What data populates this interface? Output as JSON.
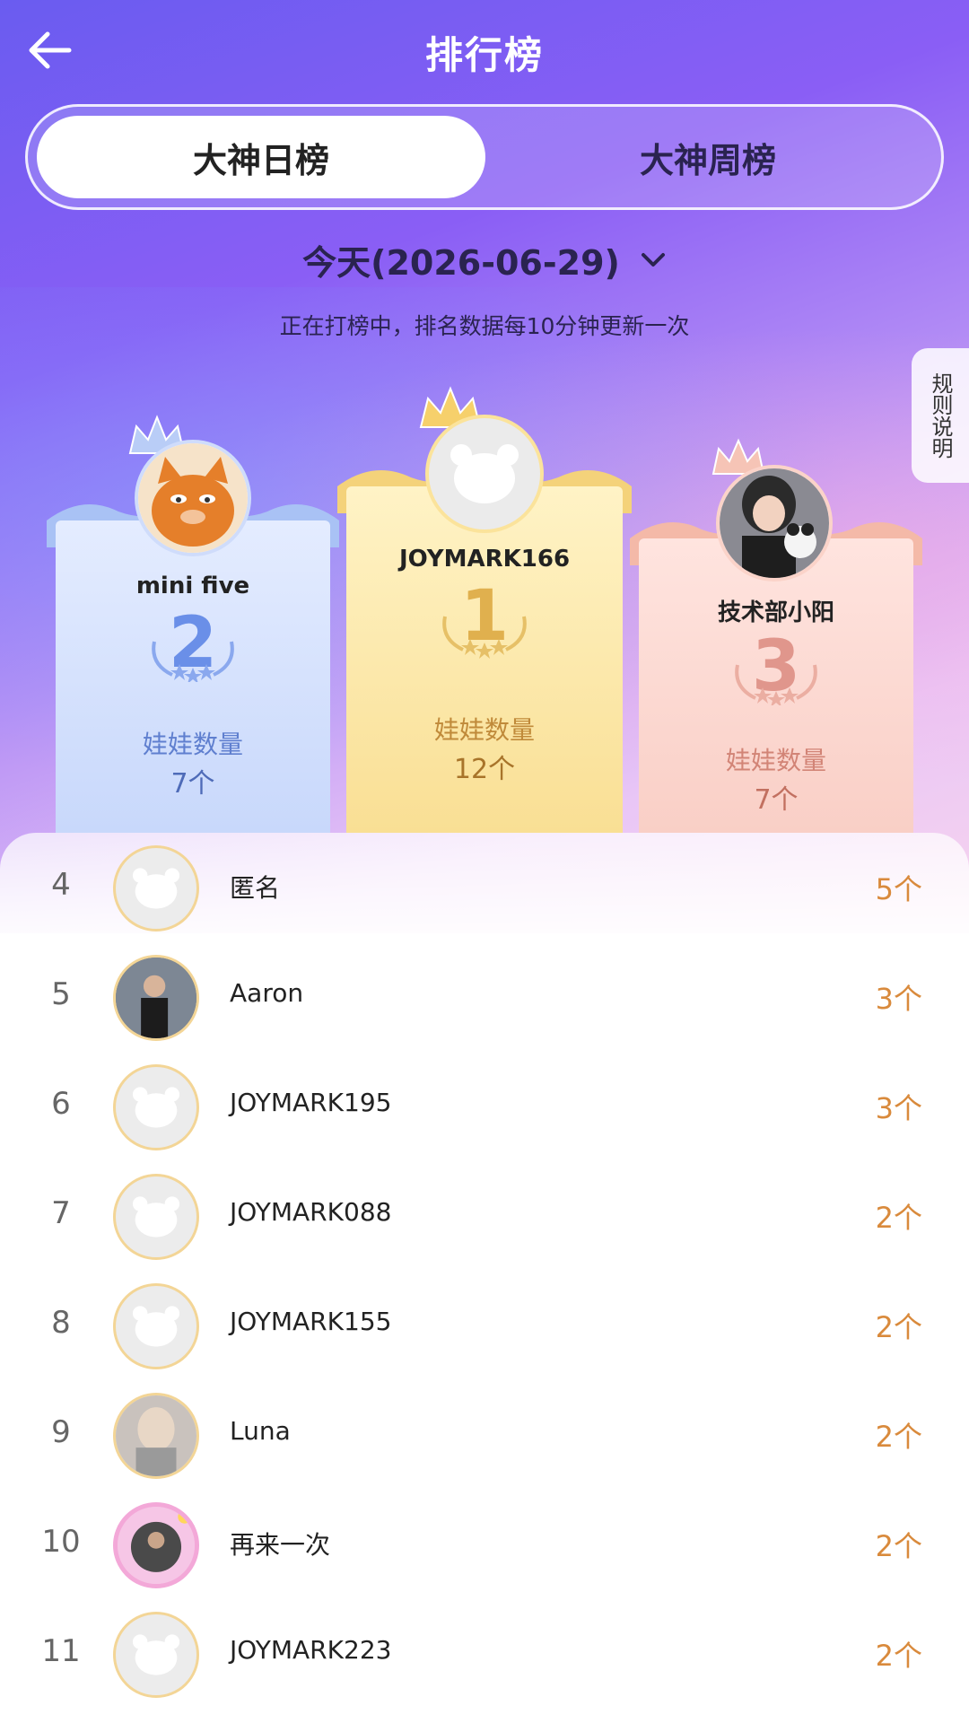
{
  "header": {
    "title": "排行榜"
  },
  "tabs": [
    {
      "label": "大神日榜",
      "active": true
    },
    {
      "label": "大神周榜",
      "active": false
    }
  ],
  "date": {
    "text": "今天(2026-06-29)"
  },
  "subtitle": "正在打榜中，排名数据每10分钟更新一次",
  "rules": {
    "label": "规则说明"
  },
  "podium": {
    "dolls_label": "娃娃数量",
    "first": {
      "rank": "1",
      "name": "JOYMARK166",
      "dolls": "12个"
    },
    "second": {
      "rank": "2",
      "name": "mini five",
      "dolls": "7个"
    },
    "third": {
      "rank": "3",
      "name": "技术部小阳",
      "dolls": "7个"
    }
  },
  "list": [
    {
      "rank": "4",
      "name": "匿名",
      "count": "5个",
      "avatar": "default"
    },
    {
      "rank": "5",
      "name": "Aaron",
      "count": "3个",
      "avatar": "photo"
    },
    {
      "rank": "6",
      "name": "JOYMARK195",
      "count": "3个",
      "avatar": "default"
    },
    {
      "rank": "7",
      "name": "JOYMARK088",
      "count": "2个",
      "avatar": "default"
    },
    {
      "rank": "8",
      "name": "JOYMARK155",
      "count": "2个",
      "avatar": "default"
    },
    {
      "rank": "9",
      "name": "Luna",
      "count": "2个",
      "avatar": "photo"
    },
    {
      "rank": "10",
      "name": "再来一次",
      "count": "2个",
      "avatar": "photo-frame"
    },
    {
      "rank": "11",
      "name": "JOYMARK223",
      "count": "2个",
      "avatar": "default"
    }
  ],
  "colors": {
    "accent_orange": "#d98a3c",
    "first_gold": "#e0b04e",
    "second_blue": "#6a8fe8",
    "third_pink": "#e0968c"
  }
}
